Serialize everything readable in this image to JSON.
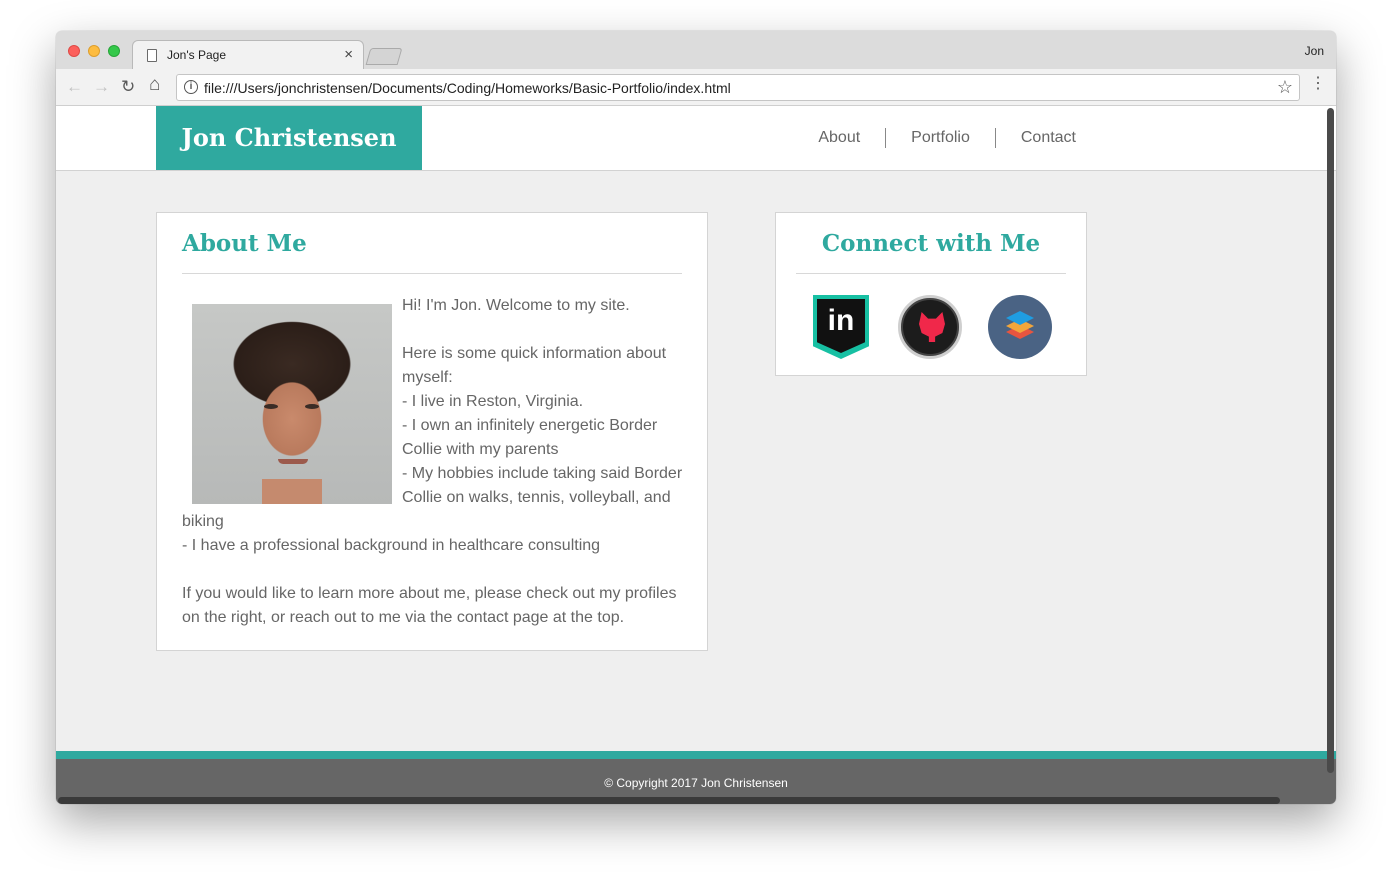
{
  "browser": {
    "tab_title": "Jon's Page",
    "tab_close": "×",
    "profile_name": "Jon",
    "url": "file:///Users/jonchristensen/Documents/Coding/Homeworks/Basic-Portfolio/index.html",
    "back_icon": "←",
    "forward_icon": "→",
    "reload_icon": "↻",
    "home_icon": "⌂",
    "info_icon": "i",
    "star_icon": "☆",
    "menu_icon": "⋮"
  },
  "site": {
    "brand": "Jon Christensen",
    "nav": [
      "About",
      "Portfolio",
      "Contact"
    ]
  },
  "about": {
    "title": "About Me",
    "intro": "Hi! I'm Jon. Welcome to my site.",
    "info_heading": "Here is some quick information about myself:",
    "bullets": [
      "- I live in Reston, Virginia.",
      "- I own an infinitely energetic Border Collie with my parents",
      "- My hobbies include taking said Border Collie on walks, tennis, volleyball, and biking",
      "- I have a professional background in healthcare consulting"
    ],
    "outro": "If you would like to learn more about me, please check out my profiles on the right, or reach out to me via the contact page at the top."
  },
  "connect": {
    "title": "Connect with Me",
    "linkedin_text": "in",
    "icons": [
      "linkedin-icon",
      "github-icon",
      "stack-overflow-icon"
    ]
  },
  "footer": {
    "copyright": "© Copyright 2017 Jon Christensen"
  },
  "colors": {
    "accent": "#2fa99f",
    "footer_bg": "#666666"
  }
}
